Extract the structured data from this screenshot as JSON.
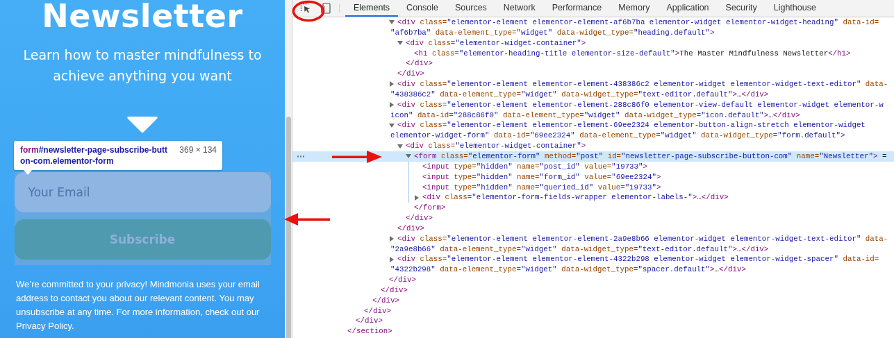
{
  "page": {
    "heading": "Newsletter",
    "subtitle": "Learn how to master mindfulness to achieve anything you want",
    "email_field": {
      "placeholder": "Your Email"
    },
    "subscribe_button": "Subscribe",
    "privacy": {
      "text": "We’re committed to your privacy! Mindmonia uses your email address to contact you about our relevant content. You may unsubscribe at any time. For more information, check out our",
      "link": "Privacy Policy",
      "end": "."
    }
  },
  "inspect_tooltip": {
    "tag": "form",
    "selector": "#newsletter-page-subscribe-button-com.elementor-form",
    "size": "369 × 134"
  },
  "devtools": {
    "tabs": [
      {
        "label": "Elements",
        "selected": true
      },
      {
        "label": "Console",
        "selected": false
      },
      {
        "label": "Sources",
        "selected": false
      },
      {
        "label": "Network",
        "selected": false
      },
      {
        "label": "Performance",
        "selected": false
      },
      {
        "label": "Memory",
        "selected": false
      },
      {
        "label": "Application",
        "selected": false
      },
      {
        "label": "Security",
        "selected": false
      },
      {
        "label": "Lighthouse",
        "selected": false
      }
    ],
    "tree": {
      "selected": false,
      "close": [
        {
          "kind": "tag",
          "text": "</section>"
        }
      ],
      "children": [
        {
          "selected": false,
          "close": [
            {
              "kind": "tag",
              "text": "</div>"
            }
          ],
          "children": [
            {
              "selected": false,
              "close": [
                {
                  "kind": "tag",
                  "text": "</div>"
                }
              ],
              "children": [
                {
                  "selected": false,
                  "close": [
                    {
                      "kind": "tag",
                      "text": "</div>"
                    }
                  ],
                  "children": [
                    {
                      "selected": false,
                      "close": [
                        {
                          "kind": "tag",
                          "text": "</div>"
                        }
                      ],
                      "children": [
                        {
                          "selected": false,
                          "close": [
                            {
                              "kind": "tag",
                              "text": "</div>"
                            }
                          ],
                          "children": [
                            {
                              "selected": false,
                              "expanded": true,
                              "lines": [
                                [
                                  {
                                    "kind": "tag",
                                    "text": "<div"
                                  },
                                  {
                                    "kind": "attr",
                                    "text": " class="
                                  },
                                  {
                                    "kind": "value",
                                    "text": "\"elementor-element elementor-element-af6b7ba elementor-widget elementor-widget-heading\""
                                  },
                                  {
                                    "kind": "attr",
                                    "text": " data-id="
                                  }
                                ],
                                [
                                  {
                                    "kind": "value",
                                    "text": "\"af6b7ba\""
                                  },
                                  {
                                    "kind": "attr",
                                    "text": " data-element_type="
                                  },
                                  {
                                    "kind": "value",
                                    "text": "\"widget\""
                                  },
                                  {
                                    "kind": "attr",
                                    "text": " data-widget_type="
                                  },
                                  {
                                    "kind": "value",
                                    "text": "\"heading.default\""
                                  },
                                  {
                                    "kind": "tag",
                                    "text": ">"
                                  }
                                ]
                              ],
                              "children": [
                                {
                                  "selected": false,
                                  "expanded": true,
                                  "lines": [
                                    [
                                      {
                                        "kind": "tag",
                                        "text": "<div"
                                      },
                                      {
                                        "kind": "attr",
                                        "text": " class="
                                      },
                                      {
                                        "kind": "value",
                                        "text": "\"elementor-widget-container\""
                                      },
                                      {
                                        "kind": "tag",
                                        "text": ">"
                                      }
                                    ]
                                  ],
                                  "children": [
                                    {
                                      "selected": false,
                                      "lines": [
                                        [
                                          {
                                            "kind": "tag",
                                            "text": "<h1"
                                          },
                                          {
                                            "kind": "attr",
                                            "text": " class="
                                          },
                                          {
                                            "kind": "value",
                                            "text": "\"elementor-heading-title elementor-size-default\""
                                          },
                                          {
                                            "kind": "tag",
                                            "text": ">"
                                          },
                                          {
                                            "kind": "text",
                                            "text": "The Master Mindfulness Newsletter"
                                          },
                                          {
                                            "kind": "tag",
                                            "text": "</h1>"
                                          }
                                        ]
                                      ]
                                    }
                                  ],
                                  "close": [
                                    {
                                      "kind": "tag",
                                      "text": "</div>"
                                    }
                                  ]
                                }
                              ],
                              "close": [
                                {
                                  "kind": "tag",
                                  "text": "</div>"
                                }
                              ]
                            },
                            {
                              "selected": false,
                              "expanded": false,
                              "lines": [
                                [
                                  {
                                    "kind": "tag",
                                    "text": "<div"
                                  },
                                  {
                                    "kind": "attr",
                                    "text": " class="
                                  },
                                  {
                                    "kind": "value",
                                    "text": "\"elementor-element elementor-element-438386c2 elementor-widget elementor-widget-text-editor\""
                                  },
                                  {
                                    "kind": "attr",
                                    "text": " data-"
                                  }
                                ],
                                [
                                  {
                                    "kind": "value",
                                    "text": "\"438386c2\""
                                  },
                                  {
                                    "kind": "attr",
                                    "text": " data-element_type="
                                  },
                                  {
                                    "kind": "value",
                                    "text": "\"widget\""
                                  },
                                  {
                                    "kind": "attr",
                                    "text": " data-widget_type="
                                  },
                                  {
                                    "kind": "value",
                                    "text": "\"text-editor.default\""
                                  },
                                  {
                                    "kind": "tag",
                                    "text": ">"
                                  },
                                  {
                                    "kind": "text",
                                    "text": "…"
                                  },
                                  {
                                    "kind": "tag",
                                    "text": "</div>"
                                  }
                                ]
                              ]
                            },
                            {
                              "selected": false,
                              "expanded": false,
                              "lines": [
                                [
                                  {
                                    "kind": "tag",
                                    "text": "<div"
                                  },
                                  {
                                    "kind": "attr",
                                    "text": " class="
                                  },
                                  {
                                    "kind": "value",
                                    "text": "\"elementor-element elementor-element-288c86f0 elementor-view-default elementor-widget elementor-w"
                                  }
                                ],
                                [
                                  {
                                    "kind": "value",
                                    "text": "icon\""
                                  },
                                  {
                                    "kind": "attr",
                                    "text": " data-id="
                                  },
                                  {
                                    "kind": "value",
                                    "text": "\"288c86f0\""
                                  },
                                  {
                                    "kind": "attr",
                                    "text": " data-element_type="
                                  },
                                  {
                                    "kind": "value",
                                    "text": "\"widget\""
                                  },
                                  {
                                    "kind": "attr",
                                    "text": " data-widget_type="
                                  },
                                  {
                                    "kind": "value",
                                    "text": "\"icon.default\""
                                  },
                                  {
                                    "kind": "tag",
                                    "text": ">"
                                  },
                                  {
                                    "kind": "text",
                                    "text": "…"
                                  },
                                  {
                                    "kind": "tag",
                                    "text": "</div>"
                                  }
                                ]
                              ]
                            },
                            {
                              "selected": false,
                              "expanded": true,
                              "lines": [
                                [
                                  {
                                    "kind": "tag",
                                    "text": "<div"
                                  },
                                  {
                                    "kind": "attr",
                                    "text": " class="
                                  },
                                  {
                                    "kind": "value",
                                    "text": "\"elementor-element elementor-element-69ee2324 elementor-button-align-stretch elementor-widget"
                                  }
                                ],
                                [
                                  {
                                    "kind": "value",
                                    "text": "elementor-widget-form\""
                                  },
                                  {
                                    "kind": "attr",
                                    "text": " data-id="
                                  },
                                  {
                                    "kind": "value",
                                    "text": "\"69ee2324\""
                                  },
                                  {
                                    "kind": "attr",
                                    "text": " data-element_type="
                                  },
                                  {
                                    "kind": "value",
                                    "text": "\"widget\""
                                  },
                                  {
                                    "kind": "attr",
                                    "text": " data-widget_type="
                                  },
                                  {
                                    "kind": "value",
                                    "text": "\"form.default\""
                                  },
                                  {
                                    "kind": "tag",
                                    "text": ">"
                                  }
                                ]
                              ],
                              "children": [
                                {
                                  "selected": false,
                                  "expanded": true,
                                  "lines": [
                                    [
                                      {
                                        "kind": "tag",
                                        "text": "<div"
                                      },
                                      {
                                        "kind": "attr",
                                        "text": " class="
                                      },
                                      {
                                        "kind": "value",
                                        "text": "\"elementor-widget-container\""
                                      },
                                      {
                                        "kind": "tag",
                                        "text": ">"
                                      }
                                    ]
                                  ],
                                  "children": [
                                    {
                                      "selected": true,
                                      "expanded": true,
                                      "lines": [
                                        [
                                          {
                                            "kind": "tag",
                                            "text": "<form"
                                          },
                                          {
                                            "kind": "attr",
                                            "text": " class="
                                          },
                                          {
                                            "kind": "value",
                                            "text": "\"elementor-form\""
                                          },
                                          {
                                            "kind": "attr",
                                            "text": " method="
                                          },
                                          {
                                            "kind": "value",
                                            "text": "\"post\""
                                          },
                                          {
                                            "kind": "attr",
                                            "text": " id="
                                          },
                                          {
                                            "kind": "value",
                                            "text": "\"newsletter-page-subscribe-button-com\""
                                          },
                                          {
                                            "kind": "attr",
                                            "text": " name="
                                          },
                                          {
                                            "kind": "value",
                                            "text": "\"Newsletter\""
                                          },
                                          {
                                            "kind": "tag",
                                            "text": ">"
                                          },
                                          {
                                            "kind": "text",
                                            "text": " ="
                                          }
                                        ]
                                      ],
                                      "children": [
                                        {
                                          "selected": false,
                                          "lines": [
                                            [
                                              {
                                                "kind": "tag",
                                                "text": "<input"
                                              },
                                              {
                                                "kind": "attr",
                                                "text": " type="
                                              },
                                              {
                                                "kind": "value",
                                                "text": "\"hidden\""
                                              },
                                              {
                                                "kind": "attr",
                                                "text": " name="
                                              },
                                              {
                                                "kind": "value",
                                                "text": "\"post_id\""
                                              },
                                              {
                                                "kind": "attr",
                                                "text": " value="
                                              },
                                              {
                                                "kind": "value",
                                                "text": "\"19733\""
                                              },
                                              {
                                                "kind": "tag",
                                                "text": ">"
                                              }
                                            ]
                                          ]
                                        },
                                        {
                                          "selected": false,
                                          "lines": [
                                            [
                                              {
                                                "kind": "tag",
                                                "text": "<input"
                                              },
                                              {
                                                "kind": "attr",
                                                "text": " type="
                                              },
                                              {
                                                "kind": "value",
                                                "text": "\"hidden\""
                                              },
                                              {
                                                "kind": "attr",
                                                "text": " name="
                                              },
                                              {
                                                "kind": "value",
                                                "text": "\"form_id\""
                                              },
                                              {
                                                "kind": "attr",
                                                "text": " value="
                                              },
                                              {
                                                "kind": "value",
                                                "text": "\"69ee2324\""
                                              },
                                              {
                                                "kind": "tag",
                                                "text": ">"
                                              }
                                            ]
                                          ]
                                        },
                                        {
                                          "selected": false,
                                          "lines": [
                                            [
                                              {
                                                "kind": "tag",
                                                "text": "<input"
                                              },
                                              {
                                                "kind": "attr",
                                                "text": " type="
                                              },
                                              {
                                                "kind": "value",
                                                "text": "\"hidden\""
                                              },
                                              {
                                                "kind": "attr",
                                                "text": " name="
                                              },
                                              {
                                                "kind": "value",
                                                "text": "\"queried_id\""
                                              },
                                              {
                                                "kind": "attr",
                                                "text": " value="
                                              },
                                              {
                                                "kind": "value",
                                                "text": "\"19733\""
                                              },
                                              {
                                                "kind": "tag",
                                                "text": ">"
                                              }
                                            ]
                                          ]
                                        },
                                        {
                                          "selected": false,
                                          "expanded": false,
                                          "lines": [
                                            [
                                              {
                                                "kind": "tag",
                                                "text": "<div"
                                              },
                                              {
                                                "kind": "attr",
                                                "text": " class="
                                              },
                                              {
                                                "kind": "value",
                                                "text": "\"elementor-form-fields-wrapper elementor-labels-\""
                                              },
                                              {
                                                "kind": "tag",
                                                "text": ">"
                                              },
                                              {
                                                "kind": "text",
                                                "text": "…"
                                              },
                                              {
                                                "kind": "tag",
                                                "text": "</div>"
                                              }
                                            ]
                                          ]
                                        }
                                      ],
                                      "close": [
                                        {
                                          "kind": "tag",
                                          "text": "</form>"
                                        }
                                      ]
                                    }
                                  ],
                                  "close": [
                                    {
                                      "kind": "tag",
                                      "text": "</div>"
                                    }
                                  ]
                                }
                              ],
                              "close": [
                                {
                                  "kind": "tag",
                                  "text": "</div>"
                                }
                              ]
                            },
                            {
                              "selected": false,
                              "expanded": false,
                              "lines": [
                                [
                                  {
                                    "kind": "tag",
                                    "text": "<div"
                                  },
                                  {
                                    "kind": "attr",
                                    "text": " class="
                                  },
                                  {
                                    "kind": "value",
                                    "text": "\"elementor-element elementor-element-2a9e8b66 elementor-widget elementor-widget-text-editor\""
                                  },
                                  {
                                    "kind": "attr",
                                    "text": " data-"
                                  }
                                ],
                                [
                                  {
                                    "kind": "value",
                                    "text": "\"2a9e8b66\""
                                  },
                                  {
                                    "kind": "attr",
                                    "text": " data-element_type="
                                  },
                                  {
                                    "kind": "value",
                                    "text": "\"widget\""
                                  },
                                  {
                                    "kind": "attr",
                                    "text": " data-widget_type="
                                  },
                                  {
                                    "kind": "value",
                                    "text": "\"text-editor.default\""
                                  },
                                  {
                                    "kind": "tag",
                                    "text": ">"
                                  },
                                  {
                                    "kind": "text",
                                    "text": "…"
                                  },
                                  {
                                    "kind": "tag",
                                    "text": "</div>"
                                  }
                                ]
                              ]
                            },
                            {
                              "selected": false,
                              "expanded": false,
                              "lines": [
                                [
                                  {
                                    "kind": "tag",
                                    "text": "<div"
                                  },
                                  {
                                    "kind": "attr",
                                    "text": " class="
                                  },
                                  {
                                    "kind": "value",
                                    "text": "\"elementor-element elementor-element-4322b298 elementor-widget elementor-widget-spacer\""
                                  },
                                  {
                                    "kind": "attr",
                                    "text": " data-id="
                                  }
                                ],
                                [
                                  {
                                    "kind": "value",
                                    "text": "\"4322b298\""
                                  },
                                  {
                                    "kind": "attr",
                                    "text": " data-element_type="
                                  },
                                  {
                                    "kind": "value",
                                    "text": "\"widget\""
                                  },
                                  {
                                    "kind": "attr",
                                    "text": " data-widget_type="
                                  },
                                  {
                                    "kind": "value",
                                    "text": "\"spacer.default\""
                                  },
                                  {
                                    "kind": "tag",
                                    "text": ">"
                                  },
                                  {
                                    "kind": "text",
                                    "text": "…"
                                  },
                                  {
                                    "kind": "tag",
                                    "text": "</div>"
                                  }
                                ]
                              ]
                            }
                          ]
                        }
                      ]
                    }
                  ]
                }
              ]
            }
          ]
        }
      ]
    }
  },
  "annotations": [
    {
      "kind": "ring"
    },
    {
      "kind": "arrow-right"
    },
    {
      "kind": "arrow-left"
    }
  ]
}
